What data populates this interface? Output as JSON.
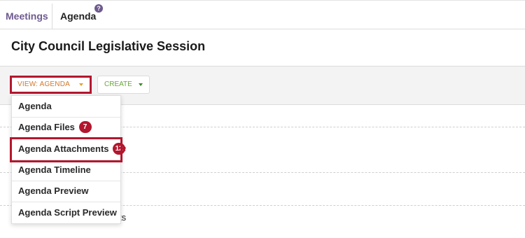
{
  "tabs": {
    "meetings": "Meetings",
    "agenda": "Agenda",
    "help_glyph": "?"
  },
  "page": {
    "title": "City Council Legislative Session"
  },
  "toolbar": {
    "view_label": "VIEW: AGENDA",
    "create_label": "CREATE"
  },
  "background": {
    "partial_1": "e",
    "partial_2": "ts"
  },
  "dropdown": {
    "items": [
      {
        "label": "Agenda",
        "badge": ""
      },
      {
        "label": "Agenda Files",
        "badge": "7"
      },
      {
        "label": "Agenda Attachments",
        "badge": "12"
      },
      {
        "label": "Agenda Timeline",
        "badge": ""
      },
      {
        "label": "Agenda Preview",
        "badge": ""
      },
      {
        "label": "Agenda Script Preview",
        "badge": ""
      }
    ]
  },
  "colors": {
    "brand_purple": "#6e5a8f",
    "highlight_red": "#b3172e",
    "view_orange": "#d0792f",
    "create_green": "#6aa83a"
  },
  "icons": {
    "help": "help-icon",
    "view_caret": "caret-down-icon",
    "create_caret": "caret-down-icon"
  }
}
